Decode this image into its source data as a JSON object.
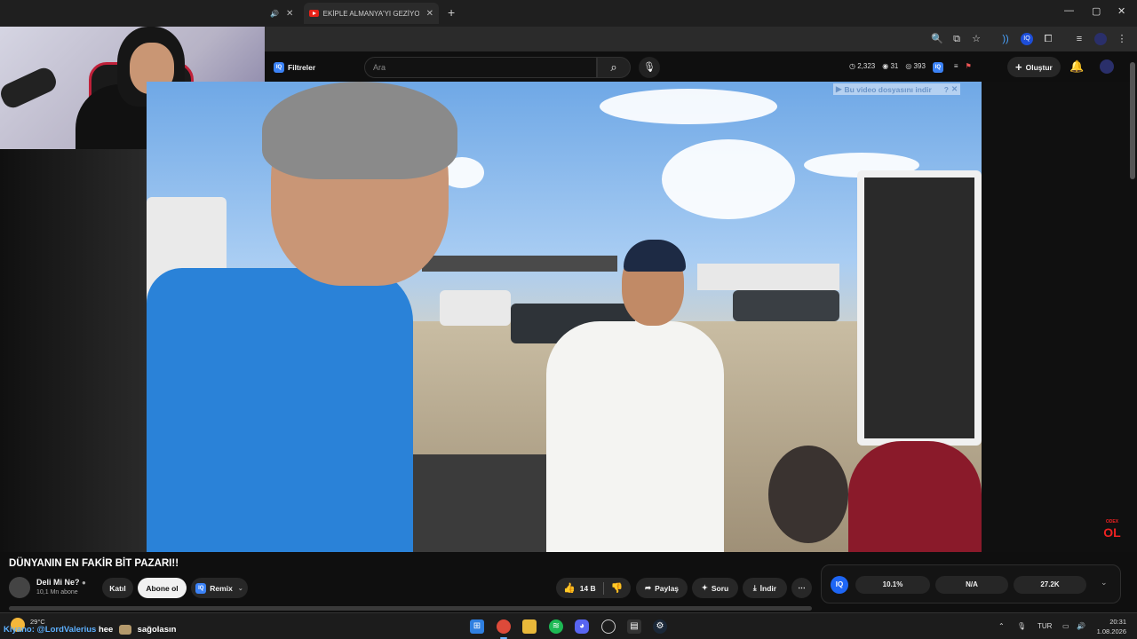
{
  "browser": {
    "tab_title": "EKİPLE ALMANYA'YI GEZİYORUZ",
    "new_tab": "+",
    "window_controls": [
      "—",
      "▢",
      "✕"
    ]
  },
  "youtube_header": {
    "filters_label": "Filtreler",
    "search_placeholder": "Ara",
    "stat_1": "2,323",
    "stat_2": "31",
    "stat_3": "393",
    "create_label": "Oluştur"
  },
  "video": {
    "download_banner": "Bu video dosyasını indir",
    "corner_logo": "ODEX OL"
  },
  "video_info": {
    "title": "DÜNYANIN EN FAKİR BİT PAZARI!!",
    "channel_name": "Deli Mi Ne?",
    "subscribers": "10,1 Mn abone",
    "join_label": "Katıl",
    "subscribe_label": "Abone ol",
    "remix_label": "Remix",
    "like_count": "14 B",
    "share_label": "Paylaş",
    "ask_label": "Soru",
    "download_label": "İndir",
    "more_label": "⋯"
  },
  "iq_panel": {
    "logo": "IQ",
    "stat_1": "10.1%",
    "stat_2": "N/A",
    "stat_3": "27.2K"
  },
  "taskbar": {
    "temperature": "29°C",
    "chat_user": "Kiyano",
    "chat_mention": "@LordValerius",
    "chat_text_1": "hee",
    "chat_text_2": "sağolasın",
    "language": "TUR",
    "time": "20:31",
    "date": "1.08.2026"
  },
  "colors": {
    "accent": "#3b82f6",
    "youtube_red": "#e62117",
    "background": "#0f0f0f"
  }
}
